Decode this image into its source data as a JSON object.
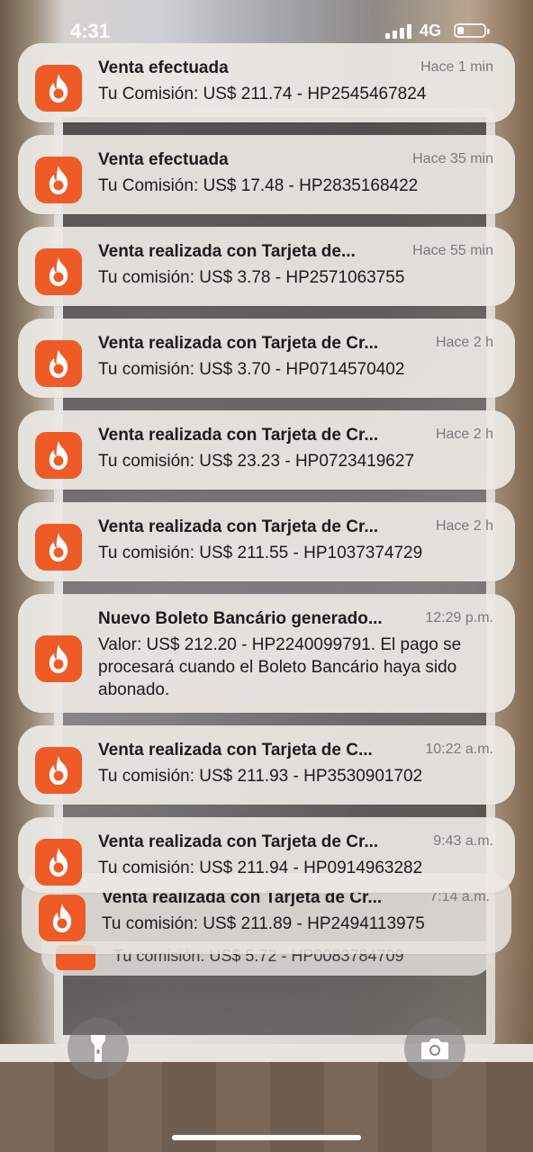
{
  "status_bar": {
    "time": "4:31",
    "network": "4G"
  },
  "notifications": [
    {
      "title": "Venta efectuada",
      "time": "Hace 1 min",
      "body": "Tu Comisión: US$ 211.74 - HP2545467824"
    },
    {
      "title": "Venta efectuada",
      "time": "Hace 35 min",
      "body": "Tu Comisión: US$ 17.48 - HP2835168422"
    },
    {
      "title": "Venta realizada con Tarjeta de...",
      "time": "Hace 55 min",
      "body": "Tu comisión: US$ 3.78 - HP2571063755"
    },
    {
      "title": "Venta realizada con Tarjeta de Cr...",
      "time": "Hace 2 h",
      "body": "Tu comisión: US$ 3.70 - HP0714570402"
    },
    {
      "title": "Venta realizada con Tarjeta de Cr...",
      "time": "Hace 2 h",
      "body": "Tu comisión: US$ 23.23 - HP0723419627"
    },
    {
      "title": "Venta realizada con Tarjeta de Cr...",
      "time": "Hace 2 h",
      "body": "Tu comisión: US$ 211.55 - HP1037374729"
    },
    {
      "title": "Nuevo Boleto Bancário generado...",
      "time": "12:29 p.m.",
      "body": "Valor: US$ 212.20 - HP2240099791. El pago se procesará cuando el Boleto Bancário haya sido abonado."
    },
    {
      "title": "Venta realizada con Tarjeta de C...",
      "time": "10:22 a.m.",
      "body": "Tu comisión: US$ 211.93 - HP3530901702"
    },
    {
      "title": "Venta realizada con Tarjeta de Cr...",
      "time": "9:43 a.m.",
      "body": "Tu comisión: US$ 211.94 - HP0914963282"
    },
    {
      "title": "Venta realizada con Tarjeta de Cr...",
      "time": "7:14 a.m.",
      "body": "Tu comisión: US$ 211.89 - HP2494113975"
    }
  ],
  "stacked_notification": {
    "body": "Tu comisión: US$ 5.72 - HP0083784709"
  },
  "controls": {
    "flashlight_icon": "flashlight-icon",
    "camera_icon": "camera-icon"
  },
  "colors": {
    "app_icon": "#ee5b26"
  }
}
